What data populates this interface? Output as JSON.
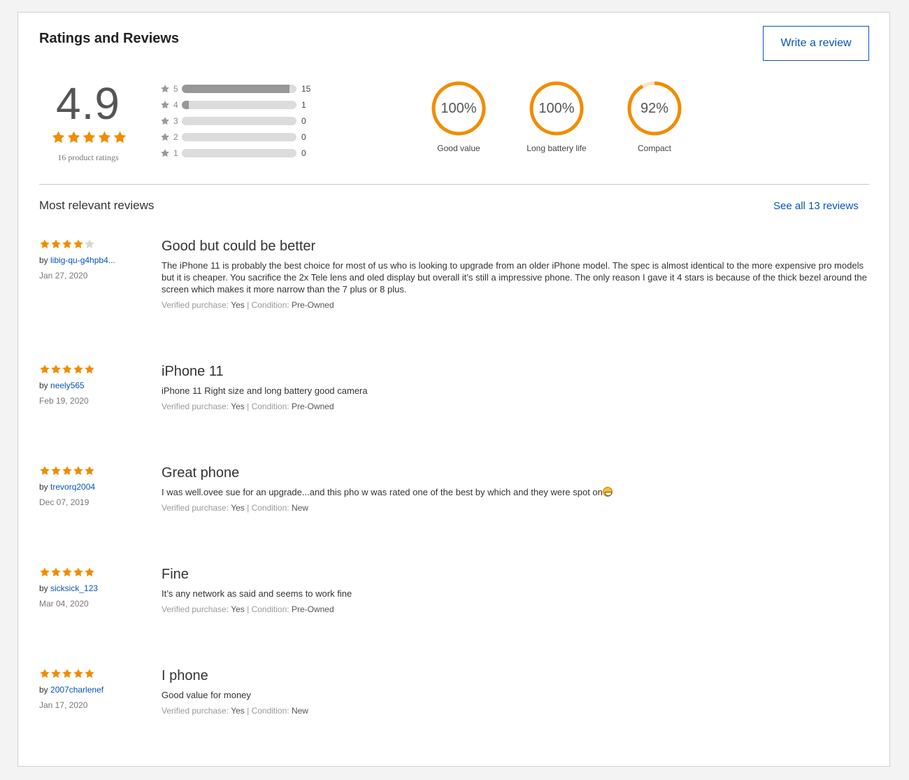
{
  "header": {
    "title": "Ratings and Reviews",
    "write_review_label": "Write a review"
  },
  "summary": {
    "average": "4.9",
    "average_stars": 5,
    "ratings_count_label": "16 product ratings",
    "histogram": [
      {
        "stars": "5",
        "count": "15",
        "fraction": 0.9375
      },
      {
        "stars": "4",
        "count": "1",
        "fraction": 0.0625
      },
      {
        "stars": "3",
        "count": "0",
        "fraction": 0
      },
      {
        "stars": "2",
        "count": "0",
        "fraction": 0
      },
      {
        "stars": "1",
        "count": "0",
        "fraction": 0
      }
    ],
    "aspects": [
      {
        "label": "Good value",
        "percent_label": "100%",
        "percent": 100
      },
      {
        "label": "Long battery life",
        "percent_label": "100%",
        "percent": 100
      },
      {
        "label": "Compact",
        "percent_label": "92%",
        "percent": 92
      }
    ]
  },
  "reviews_section": {
    "title": "Most relevant reviews",
    "see_all_label": "See all 13 reviews",
    "by_prefix": "by ",
    "verified_label": "Verified purchase: ",
    "condition_label": "Condition: ",
    "separator": " | ",
    "reviews": [
      {
        "rating": 4,
        "author": "libig-qu-g4hpb4...",
        "date": "Jan 27, 2020",
        "title": "Good but could be better",
        "body": "The iPhone 11 is probably the best choice for most of us who is looking to upgrade from an older iPhone model. The spec is almost identical to the more expensive pro models but it is cheaper. You sacrifice the 2x Tele lens and oled display but overall it’s still a impressive phone. The only reason I gave it 4 stars is because of the thick bezel around the screen which makes it more narrow than the 7 plus or 8 plus.",
        "verified": "Yes",
        "condition": "Pre-Owned",
        "has_emoji": false
      },
      {
        "rating": 5,
        "author": "neely565",
        "date": "Feb 19, 2020",
        "title": "iPhone 11",
        "body": "iPhone 11 Right size and long battery good camera",
        "verified": "Yes",
        "condition": "Pre-Owned",
        "has_emoji": false
      },
      {
        "rating": 5,
        "author": "trevorq2004",
        "date": "Dec 07, 2019",
        "title": "Great phone",
        "body": "I was well.ovee sue for an upgrade...and this pho w was rated one of the best by which and they were spot on",
        "verified": "Yes",
        "condition": "New",
        "has_emoji": true
      },
      {
        "rating": 5,
        "author": "sicksick_123",
        "date": "Mar 04, 2020",
        "title": "Fine",
        "body": "It’s any network as said and seems to work fine",
        "verified": "Yes",
        "condition": "Pre-Owned",
        "has_emoji": false
      },
      {
        "rating": 5,
        "author": "2007charlenef",
        "date": "Jan 17, 2020",
        "title": "I phone",
        "body": "Good value for money",
        "verified": "Yes",
        "condition": "New",
        "has_emoji": false
      }
    ]
  },
  "colors": {
    "star_filled": "#f18c00",
    "star_empty": "#d6d6d6",
    "ring": "#f18c00",
    "ring_track": "#fde3c4",
    "link": "#0654ba",
    "bar_fill": "#979797",
    "bar_track": "#dcdcdc"
  }
}
